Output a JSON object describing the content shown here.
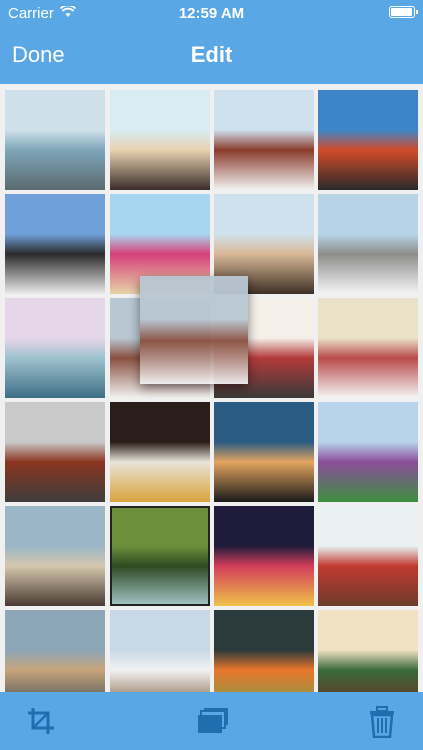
{
  "status": {
    "carrier": "Carrier",
    "time": "12:59 AM",
    "battery_level": 1.0
  },
  "nav": {
    "done_label": "Done",
    "title": "Edit"
  },
  "colors": {
    "bar": "#5aa7e6",
    "icon": "#1f6fae",
    "grid_bg": "#f0f0f0"
  },
  "photos": [
    {
      "name": "photo-island-sea",
      "subject": "person sitting by sea with island",
      "c": [
        "#cfe0ea",
        "#7ea6b8",
        "#5a6a70"
      ]
    },
    {
      "name": "photo-beach-couple",
      "subject": "couple hugging on beach",
      "c": [
        "#d9ecf3",
        "#e7d2b0",
        "#3a2c2a"
      ]
    },
    {
      "name": "photo-bridge-street",
      "subject": "street view of bridge between buildings",
      "c": [
        "#cfe1ef",
        "#8a3b2c",
        "#f2f2f2"
      ]
    },
    {
      "name": "photo-golden-gate",
      "subject": "person in front of golden gate bridge",
      "c": [
        "#3c86c7",
        "#d24b2a",
        "#2a2a2a"
      ]
    },
    {
      "name": "photo-winter-trees",
      "subject": "snowy park with trees",
      "c": [
        "#6fa0d9",
        "#2b2b2b",
        "#eaeaea"
      ]
    },
    {
      "name": "photo-lifeguard-hut",
      "subject": "pink lifeguard hut",
      "c": [
        "#a7d7f0",
        "#d6407a",
        "#e6d3a6"
      ]
    },
    {
      "name": "photo-rocks-people",
      "subject": "people standing on rocks",
      "c": [
        "#cfe1ec",
        "#d8b896",
        "#3d3026"
      ]
    },
    {
      "name": "photo-swans-lake",
      "subject": "swans on a lake",
      "c": [
        "#b7d4e6",
        "#8d8e8c",
        "#f5f5f5"
      ]
    },
    {
      "name": "photo-rainbow-sea",
      "subject": "sea with rainbow",
      "c": [
        "#e6d6e9",
        "#9fc2cf",
        "#3d6f87"
      ]
    },
    {
      "name": "photo-snow-street",
      "subject": "snowy street with buildings",
      "c": [
        "#b9c7d3",
        "#8a5040",
        "#f1f1f1"
      ]
    },
    {
      "name": "photo-instagram-lettering",
      "subject": "hearts and lettering",
      "c": [
        "#f4efe8",
        "#b33a3a",
        "#3a3a3a"
      ]
    },
    {
      "name": "photo-cat",
      "subject": "cat lying on blanket",
      "c": [
        "#e9e1c8",
        "#b94b4b",
        "#f4f4f4"
      ]
    },
    {
      "name": "photo-city-trees",
      "subject": "street with trees and buildings",
      "c": [
        "#c9c9c9",
        "#8b3520",
        "#3d3d3d"
      ]
    },
    {
      "name": "photo-breakfast-plate",
      "subject": "breakfast plate from above",
      "c": [
        "#2a1e1a",
        "#e8e4d8",
        "#d9a33a"
      ]
    },
    {
      "name": "photo-palm-sunset",
      "subject": "palm trees at sunset",
      "c": [
        "#2a5c83",
        "#e3a45f",
        "#1a1a1a"
      ]
    },
    {
      "name": "photo-graffiti-wall",
      "subject": "graffiti wall with face",
      "c": [
        "#b8d3ec",
        "#8a4d9a",
        "#3e8f3e"
      ]
    },
    {
      "name": "photo-coffee-cup",
      "subject": "coffee cup and cookie",
      "c": [
        "#9bb7c7",
        "#d4c7ad",
        "#4a3a32"
      ]
    },
    {
      "name": "photo-forest-river",
      "subject": "trees over a river",
      "c": [
        "#6b8f3a",
        "#2d4a22",
        "#a7c6c9"
      ]
    },
    {
      "name": "photo-city-night",
      "subject": "city lights at night",
      "c": [
        "#1f1b3a",
        "#d23d5a",
        "#f0c24a"
      ]
    },
    {
      "name": "photo-girl-tulips",
      "subject": "girl with red tulips",
      "c": [
        "#e9f1f3",
        "#c23a32",
        "#6c3b2a"
      ]
    },
    {
      "name": "photo-coastal-town",
      "subject": "coastal town with mountains",
      "c": [
        "#8da6b8",
        "#c7a47a",
        "#3d4d55"
      ]
    },
    {
      "name": "photo-snow-house",
      "subject": "snowy trees and house",
      "c": [
        "#c9d8e6",
        "#f2f2f2",
        "#7a5a3c"
      ]
    },
    {
      "name": "photo-oranges",
      "subject": "oranges on dark surface",
      "c": [
        "#2b3a3c",
        "#e8762c",
        "#7ba04a"
      ]
    },
    {
      "name": "photo-starbucks-cup",
      "subject": "coffee cup with dessert",
      "c": [
        "#f1e2c4",
        "#3a6a3a",
        "#6a2e22"
      ]
    }
  ],
  "dragging": {
    "name": "photo-snow-street-dragging",
    "subject": "snowy street being dragged",
    "c": [
      "#b9c7d3",
      "#8a5040",
      "#f1f1f1"
    ]
  },
  "toolbar": {
    "crop_icon": "crop-icon",
    "move_icon": "copy-stack-icon",
    "delete_icon": "trash-icon"
  }
}
